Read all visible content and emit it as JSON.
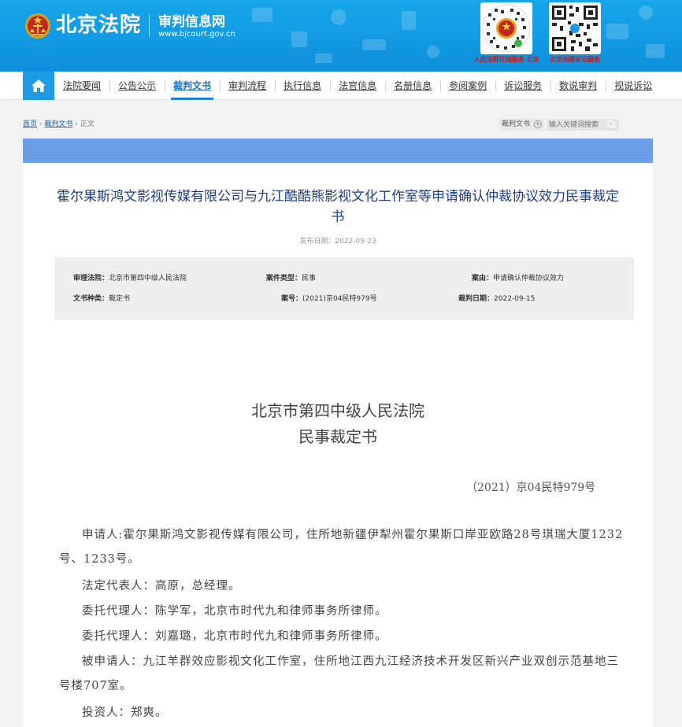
{
  "header": {
    "site_name": "北京法院",
    "subtitle": "审判信息网",
    "url": "www.bjcourt.gov.cn",
    "qr_left_label": "人民法院在线服务 北京",
    "qr_right_label": "北京法院诉讼服务"
  },
  "nav": {
    "items": [
      {
        "label": "法院要闻"
      },
      {
        "label": "公告公示"
      },
      {
        "label": "裁判文书",
        "active": true
      },
      {
        "label": "审判流程"
      },
      {
        "label": "执行信息"
      },
      {
        "label": "法官信息"
      },
      {
        "label": "名册信息"
      },
      {
        "label": "参阅案例"
      },
      {
        "label": "诉讼服务"
      },
      {
        "label": "数说审判"
      },
      {
        "label": "视说诉讼"
      }
    ]
  },
  "breadcrumb": {
    "home": "首页",
    "sep1": " › ",
    "section": "裁判文书",
    "sep2": " › ",
    "current": "正文"
  },
  "search": {
    "type": "裁判文书",
    "placeholder": "输入关键词搜索"
  },
  "document": {
    "title": "霍尔果斯鸿文影视传媒有限公司与九江酷酷熊影视文化工作室等申请确认仲裁协议效力民事裁定书",
    "publish_date": "发布日期：2022-09-23",
    "meta": {
      "court_label": "审理法院：",
      "court": "北京市第四中级人民法院",
      "case_type_label": "案件类型：",
      "case_type": "民事",
      "cause_label": "案由：",
      "cause": "申请确认仲裁协议效力",
      "doc_type_label": "文书种类：",
      "doc_type": "裁定书",
      "case_no_label": "案号：",
      "case_no": "(2021)京04民特979号",
      "judge_date_label": "裁判日期：",
      "judge_date": "2022-09-15"
    },
    "court_heading": "北京市第四中级人民法院",
    "doc_heading": "民事裁定书",
    "case_number": "（2021）京04民特979号",
    "paragraphs": [
      "申请人:霍尔果斯鸿文影视传媒有限公司，住所地新疆伊犁州霍尔果斯口岸亚欧路28号琪瑞大厦1232号、1233号。",
      "法定代表人：高原，总经理。",
      "委托代理人：陈学军，北京市时代九和律师事务所律师。",
      "委托代理人：刘嘉璐，北京市时代九和律师事务所律师。",
      "被申请人：九江羊群效应影视文化工作室，住所地江西九江经济技术开发区新兴产业双创示范基地三号楼707室。",
      "投资人：郑爽。"
    ]
  },
  "colors": {
    "header_blue": "#119adf",
    "nav_active": "#1a6fc4",
    "title_blue": "#1d3f8a",
    "content_bar": "#6a9ee8",
    "qr_label_red": "#c7191b"
  }
}
